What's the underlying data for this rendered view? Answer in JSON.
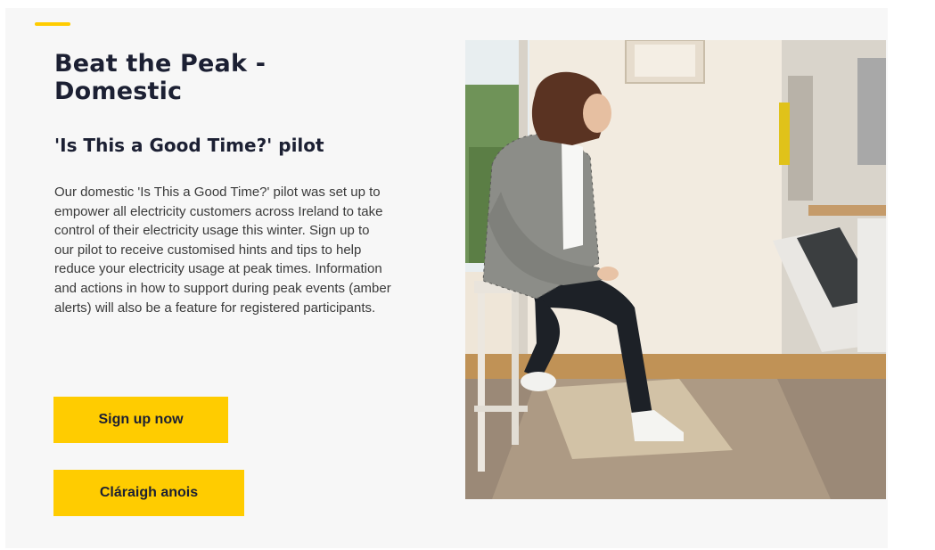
{
  "section": {
    "title": "Beat the Peak - Domestic",
    "subtitle": "'Is This a Good Time?' pilot",
    "body": "Our domestic 'Is This a Good Time?' pilot was set up to empower all electricity customers across Ireland to take control of their electricity usage this winter. Sign up to our pilot to receive customised hints and tips to help reduce your electricity usage at peak times. Information and actions in how to support during peak events (amber alerts) will also be a feature for registered participants."
  },
  "buttons": {
    "sign_up": "Sign up now",
    "claraigh": "Cláraigh anois"
  },
  "colors": {
    "accent": "#ffcc00",
    "heading": "#1c2033",
    "card_background": "#f7f7f7"
  }
}
